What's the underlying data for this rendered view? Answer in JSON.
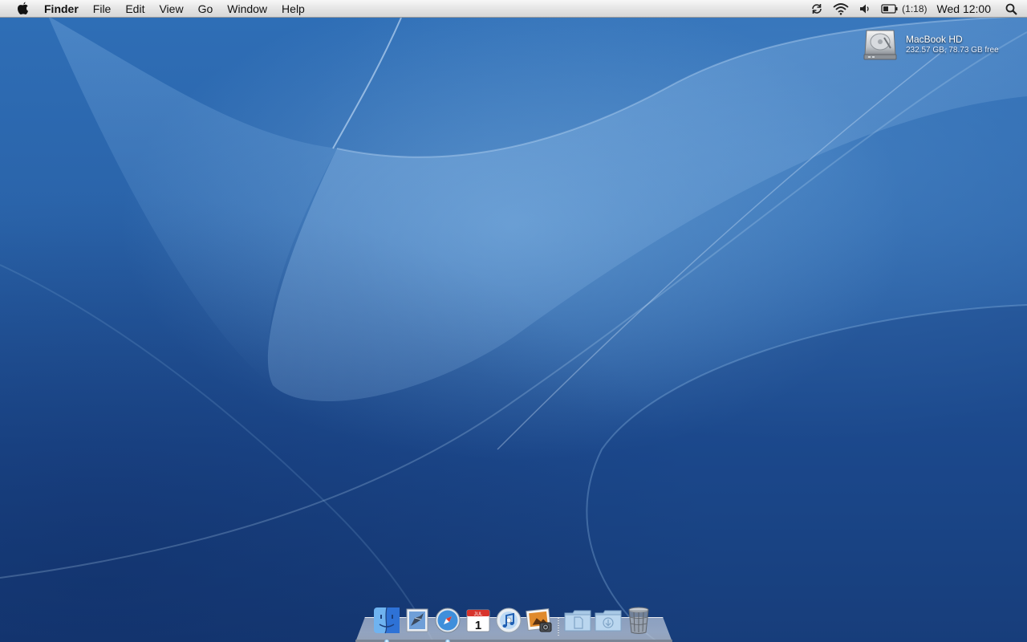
{
  "menubar": {
    "apple_icon": "apple-logo-icon",
    "items": [
      {
        "label": "Finder"
      },
      {
        "label": "File"
      },
      {
        "label": "Edit"
      },
      {
        "label": "View"
      },
      {
        "label": "Go"
      },
      {
        "label": "Window"
      },
      {
        "label": "Help"
      }
    ],
    "status": {
      "sync_icon": "sync-icon",
      "wifi_icon": "wifi-icon",
      "volume_icon": "volume-icon",
      "battery_icon": "battery-icon",
      "battery_time": "(1:18)",
      "clock": "Wed 12:00",
      "search_icon": "spotlight-search-icon"
    }
  },
  "desktop": {
    "disk": {
      "name": "MacBook HD",
      "info": "232.57 GB, 78.73 GB free",
      "icon": "hard-disk-icon"
    }
  },
  "dock": {
    "apps": [
      {
        "icon": "finder-icon",
        "running": true
      },
      {
        "icon": "mail-icon",
        "running": false
      },
      {
        "icon": "safari-icon",
        "running": true
      },
      {
        "icon": "ical-icon",
        "running": false,
        "date": "1",
        "month": "JUL"
      },
      {
        "icon": "itunes-icon",
        "running": false
      },
      {
        "icon": "iphoto-icon",
        "running": false
      }
    ],
    "stacks": [
      {
        "icon": "documents-folder-icon"
      },
      {
        "icon": "downloads-folder-icon"
      },
      {
        "icon": "trash-icon"
      }
    ]
  },
  "colors": {
    "wallpaper": "#2a63a9",
    "menubar": "#e4e4e4"
  }
}
